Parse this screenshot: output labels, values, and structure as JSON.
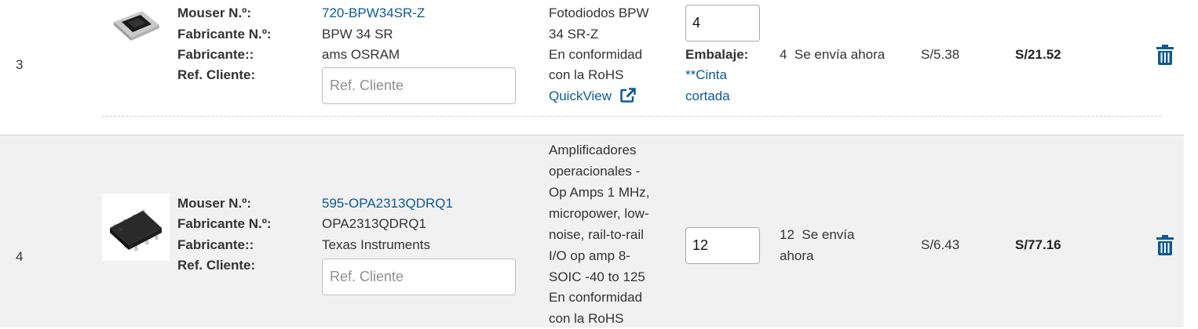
{
  "rows": [
    {
      "index": "3",
      "labels": {
        "mouser": "Mouser N.º:",
        "manufacturer_no": "Fabricante N.º:",
        "manufacturer": "Fabricante::",
        "customer_ref": "Ref. Cliente:"
      },
      "mouser_no": "720-BPW34SR-Z",
      "manufacturer_no": "BPW 34 SR",
      "manufacturer": "ams OSRAM",
      "ref_placeholder": "Ref. Cliente",
      "description": [
        "Fotodiodos BPW",
        "34 SR-Z"
      ],
      "rohs": [
        "En conformidad",
        "con la RoHS"
      ],
      "quickview": "QuickView",
      "quantity": "4",
      "packaging_label": "Embalaje:",
      "packaging_value": [
        "**Cinta",
        "cortada"
      ],
      "availability": "4  Se envía ahora",
      "unit_price": "S/5.38",
      "ext_price": "S/21.52",
      "image_icon": "photodiode-image",
      "delete_icon": "trash-icon"
    },
    {
      "index": "4",
      "labels": {
        "mouser": "Mouser N.º:",
        "manufacturer_no": "Fabricante N.º:",
        "manufacturer": "Fabricante::",
        "customer_ref": "Ref. Cliente:"
      },
      "mouser_no": "595-OPA2313QDRQ1",
      "manufacturer_no": "OPA2313QDRQ1",
      "manufacturer": "Texas Instruments",
      "ref_placeholder": "Ref. Cliente",
      "description": [
        "Amplificadores",
        "operacionales -",
        "Op Amps 1 MHz,",
        "micropower, low-",
        "noise, rail-to-rail",
        "I/O op amp 8-",
        "SOIC -40 to 125"
      ],
      "rohs": [
        "En conformidad",
        "con la RoHS"
      ],
      "quantity": "12",
      "availability": [
        "12  Se envía",
        "ahora"
      ],
      "unit_price": "S/6.43",
      "ext_price": "S/77.16",
      "image_icon": "soic-chip-image",
      "delete_icon": "trash-icon"
    }
  ],
  "colors": {
    "link": "#0c5a96",
    "trash": "#0c5a96",
    "row_alt_bg": "#f1f1f1"
  }
}
